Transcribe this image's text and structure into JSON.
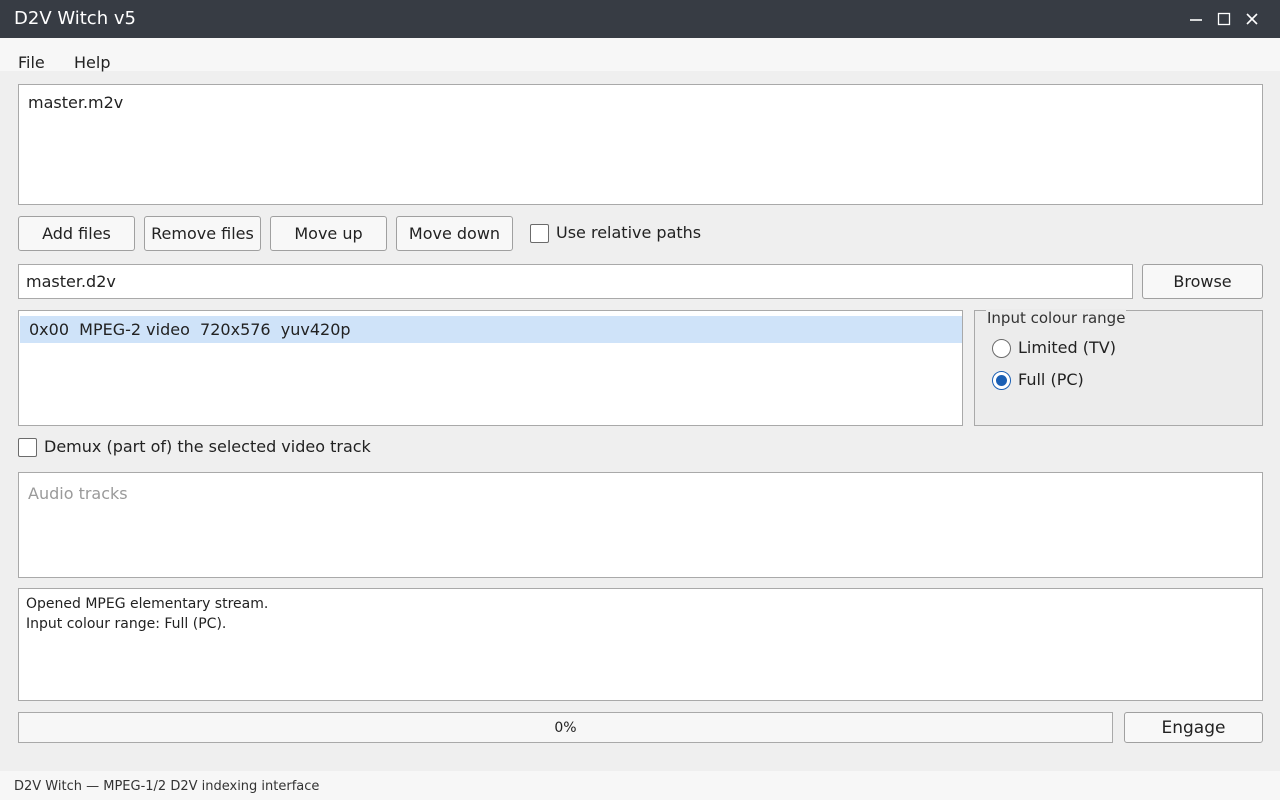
{
  "window": {
    "title": "D2V Witch v5",
    "controls": [
      "minimize-icon",
      "maximize-icon",
      "close-icon"
    ]
  },
  "menu": {
    "file": "File",
    "help": "Help"
  },
  "input_files": {
    "items": [
      "master.m2v"
    ]
  },
  "file_buttons": {
    "add": "Add files",
    "remove": "Remove files",
    "move_up": "Move up",
    "move_down": "Move down"
  },
  "relative_paths": {
    "label": "Use relative paths",
    "checked": false
  },
  "output": {
    "value": "master.d2v",
    "browse": "Browse"
  },
  "video_tracks": {
    "items": [
      "0x00  MPEG-2 video  720x576  yuv420p"
    ],
    "selected_index": 0
  },
  "colour_range": {
    "title": "Input colour range",
    "options": [
      "Limited (TV)",
      "Full (PC)"
    ],
    "selected": "Full (PC)"
  },
  "demux": {
    "label": "Demux (part of) the selected video track",
    "checked": false
  },
  "audio_tracks": {
    "placeholder": "Audio tracks"
  },
  "log": {
    "lines": [
      "Opened MPEG elementary stream.",
      "Input colour range: Full (PC)."
    ]
  },
  "progress": {
    "value": 0,
    "text": "0%"
  },
  "engage": "Engage",
  "status": "D2V Witch — MPEG-1/2 D2V indexing interface",
  "colors": {
    "titlebar": "#373c44",
    "selection": "#cfe3f9",
    "accent": "#1a5fb4"
  }
}
